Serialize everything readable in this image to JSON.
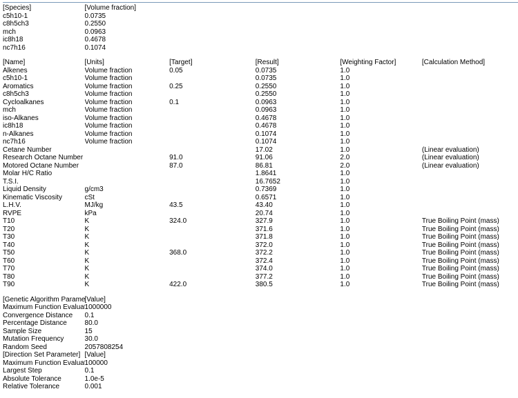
{
  "species_table": {
    "headers": [
      "[Species]",
      "[Volume fraction]"
    ],
    "rows": [
      {
        "name": "c5h10-1",
        "vf": "0.0735"
      },
      {
        "name": "c8h5ch3",
        "vf": "0.2550"
      },
      {
        "name": "mch",
        "vf": "0.0963"
      },
      {
        "name": "ic8h18",
        "vf": "0.4678"
      },
      {
        "name": "nc7h16",
        "vf": "0.1074"
      }
    ]
  },
  "targets_table": {
    "headers": [
      "[Name]",
      "[Units]",
      "[Target]",
      "[Result]",
      "[Weighting Factor]",
      "[Calculation Method]"
    ],
    "rows": [
      {
        "name": "Alkenes",
        "units": "Volume fraction",
        "target": "0.05",
        "result": "0.0735",
        "wf": "1.0",
        "method": ""
      },
      {
        "name": "c5h10-1",
        "units": "Volume fraction",
        "target": "",
        "result": "0.0735",
        "wf": "1.0",
        "method": ""
      },
      {
        "name": "Aromatics",
        "units": "Volume fraction",
        "target": "0.25",
        "result": "0.2550",
        "wf": "1.0",
        "method": ""
      },
      {
        "name": "c8h5ch3",
        "units": "Volume fraction",
        "target": "",
        "result": "0.2550",
        "wf": "1.0",
        "method": ""
      },
      {
        "name": "Cycloalkanes",
        "units": "Volume fraction",
        "target": "0.1",
        "result": "0.0963",
        "wf": "1.0",
        "method": ""
      },
      {
        "name": "mch",
        "units": "Volume fraction",
        "target": "",
        "result": "0.0963",
        "wf": "1.0",
        "method": ""
      },
      {
        "name": "iso-Alkanes",
        "units": "Volume fraction",
        "target": "",
        "result": "0.4678",
        "wf": "1.0",
        "method": ""
      },
      {
        "name": "ic8h18",
        "units": "Volume fraction",
        "target": "",
        "result": "0.4678",
        "wf": "1.0",
        "method": ""
      },
      {
        "name": "n-Alkanes",
        "units": "Volume fraction",
        "target": "",
        "result": "0.1074",
        "wf": "1.0",
        "method": ""
      },
      {
        "name": "nc7h16",
        "units": "Volume fraction",
        "target": "",
        "result": "0.1074",
        "wf": "1.0",
        "method": ""
      },
      {
        "name": "Cetane Number",
        "units": "",
        "target": "",
        "result": "17.02",
        "wf": "1.0",
        "method": "(Linear evaluation)"
      },
      {
        "name": "Research Octane Number",
        "units": "",
        "target": "91.0",
        "result": "91.06",
        "wf": "2.0",
        "method": "(Linear evaluation)"
      },
      {
        "name": "Motored Octane Number",
        "units": "",
        "target": "87.0",
        "result": "86.81",
        "wf": "2.0",
        "method": "(Linear evaluation)"
      },
      {
        "name": "Molar H/C Ratio",
        "units": "",
        "target": "",
        "result": "1.8641",
        "wf": "1.0",
        "method": ""
      },
      {
        "name": "T.S.I.",
        "units": "",
        "target": "",
        "result": "16.7652",
        "wf": "1.0",
        "method": ""
      },
      {
        "name": "Liquid Density",
        "units": "g/cm3",
        "target": "",
        "result": "0.7369",
        "wf": "1.0",
        "method": ""
      },
      {
        "name": "Kinematic Viscosity",
        "units": "cSt",
        "target": "",
        "result": "0.6571",
        "wf": "1.0",
        "method": ""
      },
      {
        "name": "L.H.V.",
        "units": "MJ/kg",
        "target": "43.5",
        "result": "43.40",
        "wf": "1.0",
        "method": ""
      },
      {
        "name": "RVPE",
        "units": "kPa",
        "target": "",
        "result": "20.74",
        "wf": "1.0",
        "method": ""
      },
      {
        "name": "T10",
        "units": "K",
        "target": "324.0",
        "result": "327.9",
        "wf": "1.0",
        "method": "True Boiling Point (mass)"
      },
      {
        "name": "T20",
        "units": "K",
        "target": "",
        "result": "371.6",
        "wf": "1.0",
        "method": "True Boiling Point (mass)"
      },
      {
        "name": "T30",
        "units": "K",
        "target": "",
        "result": "371.8",
        "wf": "1.0",
        "method": "True Boiling Point (mass)"
      },
      {
        "name": "T40",
        "units": "K",
        "target": "",
        "result": "372.0",
        "wf": "1.0",
        "method": "True Boiling Point (mass)"
      },
      {
        "name": "T50",
        "units": "K",
        "target": "368.0",
        "result": "372.2",
        "wf": "1.0",
        "method": "True Boiling Point (mass)"
      },
      {
        "name": "T60",
        "units": "K",
        "target": "",
        "result": "372.4",
        "wf": "1.0",
        "method": "True Boiling Point (mass)"
      },
      {
        "name": "T70",
        "units": "K",
        "target": "",
        "result": "374.0",
        "wf": "1.0",
        "method": "True Boiling Point (mass)"
      },
      {
        "name": "T80",
        "units": "K",
        "target": "",
        "result": "377.2",
        "wf": "1.0",
        "method": "True Boiling Point (mass)"
      },
      {
        "name": "T90",
        "units": "K",
        "target": "422.0",
        "result": "380.5",
        "wf": "1.0",
        "method": "True Boiling Point (mass)"
      }
    ]
  },
  "ga_table": {
    "headers": [
      "[Genetic Algorithm Parameter]",
      "[Value]"
    ],
    "rows": [
      {
        "name": "Maximum Function Evaluations",
        "value": "1000000"
      },
      {
        "name": "Convergence Distance",
        "value": "0.1"
      },
      {
        "name": "Percentage Distance",
        "value": "80.0"
      },
      {
        "name": "Sample Size",
        "value": "15"
      },
      {
        "name": "Mutation Frequency",
        "value": "30.0"
      },
      {
        "name": "Random Seed",
        "value": "2057808254"
      }
    ]
  },
  "ds_table": {
    "headers": [
      "[Direction Set Parameter]",
      "[Value]"
    ],
    "rows": [
      {
        "name": "Maximum Function Evaluations",
        "value": "100000"
      },
      {
        "name": "Largest Step",
        "value": "0.1"
      },
      {
        "name": "Absolute Tolerance",
        "value": "1.0e-5"
      },
      {
        "name": "Relative Tolerance",
        "value": "0.001"
      }
    ]
  }
}
